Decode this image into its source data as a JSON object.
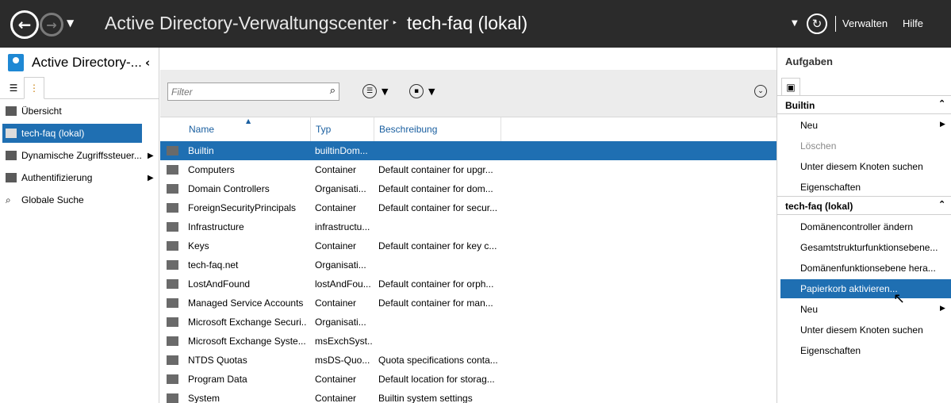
{
  "header": {
    "app_title": "Active Directory-Verwaltungscenter",
    "breadcrumb_sep": "‣",
    "current_node": "tech-faq (lokal)",
    "back_icon": "back-arrow",
    "forward_icon": "forward-arrow",
    "manage_label": "Verwalten",
    "help_label": "Hilfe"
  },
  "nav": {
    "title": "Active Directory-...",
    "items": [
      {
        "label": "Übersicht",
        "arrow": ""
      },
      {
        "label": "tech-faq (lokal)",
        "arrow": "▶"
      },
      {
        "label": "Dynamische Zugriffssteuer...",
        "arrow": "▶"
      },
      {
        "label": "Authentifizierung",
        "arrow": "▶"
      },
      {
        "label": "Globale Suche",
        "arrow": ""
      }
    ]
  },
  "content": {
    "filter_placeholder": "Filter",
    "columns": {
      "name": "Name",
      "type": "Typ",
      "description": "Beschreibung"
    },
    "rows": [
      {
        "name": "Builtin",
        "type": "builtinDom...",
        "desc": ""
      },
      {
        "name": "Computers",
        "type": "Container",
        "desc": "Default container for upgr..."
      },
      {
        "name": "Domain Controllers",
        "type": "Organisati...",
        "desc": "Default container for dom..."
      },
      {
        "name": "ForeignSecurityPrincipals",
        "type": "Container",
        "desc": "Default container for secur..."
      },
      {
        "name": "Infrastructure",
        "type": "infrastructu...",
        "desc": ""
      },
      {
        "name": "Keys",
        "type": "Container",
        "desc": "Default container for key c..."
      },
      {
        "name": "tech-faq.net",
        "type": "Organisati...",
        "desc": ""
      },
      {
        "name": "LostAndFound",
        "type": "lostAndFou...",
        "desc": "Default container for orph..."
      },
      {
        "name": "Managed Service Accounts",
        "type": "Container",
        "desc": "Default container for man..."
      },
      {
        "name": "Microsoft Exchange Securi...",
        "type": "Organisati...",
        "desc": ""
      },
      {
        "name": "Microsoft Exchange Syste...",
        "type": "msExchSyst...",
        "desc": ""
      },
      {
        "name": "NTDS Quotas",
        "type": "msDS-Quo...",
        "desc": "Quota specifications conta..."
      },
      {
        "name": "Program Data",
        "type": "Container",
        "desc": "Default location for storag..."
      },
      {
        "name": "System",
        "type": "Container",
        "desc": "Builtin system settings"
      }
    ],
    "selected_row": "Builtin"
  },
  "tasks": {
    "title": "Aufgaben",
    "builtin_section": "Builtin",
    "builtin_items": [
      {
        "label": "Neu",
        "sub": "▶"
      },
      {
        "label": "Löschen",
        "sub": ""
      },
      {
        "label": "Unter diesem Knoten suchen",
        "sub": ""
      },
      {
        "label": "Eigenschaften",
        "sub": ""
      }
    ],
    "techfaq_section": "tech-faq (lokal)",
    "techfaq_items": [
      {
        "label": "Domänencontroller ändern",
        "sub": ""
      },
      {
        "label": "Gesamtstrukturfunktionsebene...",
        "sub": ""
      },
      {
        "label": "Domänenfunktionsebene hera...",
        "sub": ""
      },
      {
        "label": "Papierkorb aktivieren...",
        "sub": ""
      },
      {
        "label": "Neu",
        "sub": "▶"
      },
      {
        "label": "Unter diesem Knoten suchen",
        "sub": ""
      },
      {
        "label": "Eigenschaften",
        "sub": ""
      }
    ]
  },
  "colors": {
    "accent": "#1f6fb2",
    "titlebar": "#2b2b2b"
  }
}
